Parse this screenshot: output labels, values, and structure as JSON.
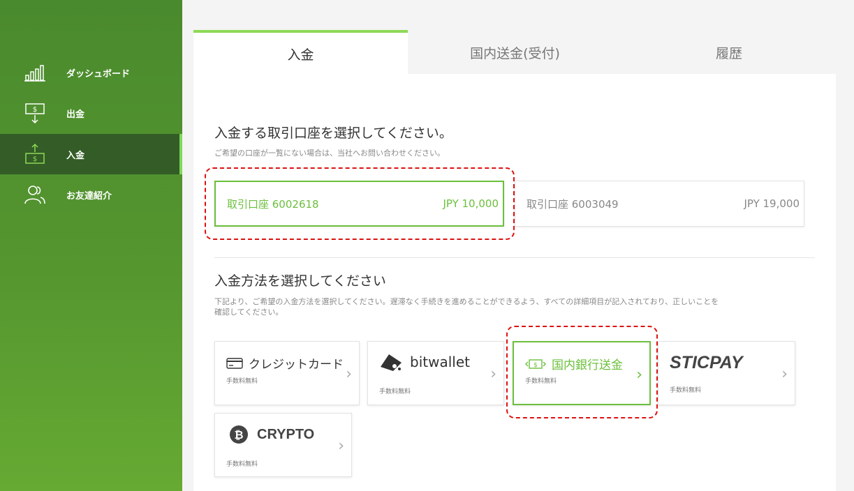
{
  "sidebar": {
    "items": [
      {
        "label": "ダッシュボード",
        "icon": "bar-chart-icon"
      },
      {
        "label": "出金",
        "icon": "withdraw-icon"
      },
      {
        "label": "入金",
        "icon": "deposit-icon"
      },
      {
        "label": "お友達紹介",
        "icon": "users-icon"
      }
    ]
  },
  "tabs": [
    {
      "label": "入金"
    },
    {
      "label": "国内送金(受付)"
    },
    {
      "label": "履歴"
    }
  ],
  "account_section": {
    "title": "入金する取引口座を選択してください。",
    "note": "ご希望の口座が一覧にない場合は、当社へお問い合わせください。",
    "accounts": [
      {
        "name": "取引口座 6002618",
        "balance": "JPY 10,000"
      },
      {
        "name": "取引口座 6003049",
        "balance": "JPY 19,000"
      }
    ]
  },
  "method_section": {
    "title": "入金方法を選択してください",
    "note_line1": "下記より、ご希望の入金方法を選択してください。遅滞なく手続きを進めることができるよう、すべての詳細項目が記入されており、正しいことを",
    "note_line2": "確認してください。",
    "methods": [
      {
        "name": "クレジットカード",
        "fee": "手数料無料",
        "icon": "credit-card-icon"
      },
      {
        "name": "bitwallet",
        "fee": "手数料無料",
        "icon": "bitwallet-logo-icon"
      },
      {
        "name": "国内銀行送金",
        "fee": "手数料無料",
        "icon": "bank-transfer-icon"
      },
      {
        "name": "STICPAY",
        "fee": "手数料無料",
        "icon": "sticpay-logo-icon"
      },
      {
        "name": "CRYPTO",
        "fee": "手数料無料",
        "icon": "bitcoin-icon"
      }
    ]
  },
  "chevron": "›",
  "colors": {
    "accent": "#6bbf3c",
    "sidebar": "#4a8a2e",
    "highlight": "#dd1111"
  }
}
